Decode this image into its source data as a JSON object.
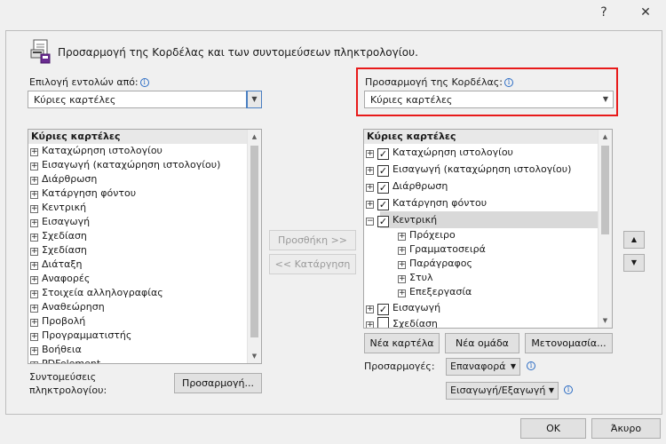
{
  "window": {
    "help_symbol": "?",
    "close_symbol": "✕"
  },
  "header": {
    "title": "Προσαρμογή της Κορδέλας και των συντομεύσεων πληκτρολογίου."
  },
  "left": {
    "choose_label": "Επιλογή εντολών από:",
    "choose_value": "Κύριες καρτέλες",
    "list_header": "Κύριες καρτέλες",
    "items": [
      "Καταχώρηση ιστολογίου",
      "Εισαγωγή (καταχώρηση ιστολογίου)",
      "Διάρθρωση",
      "Κατάργηση φόντου",
      "Κεντρική",
      "Εισαγωγή",
      "Σχεδίαση",
      "Σχεδίαση",
      "Διάταξη",
      "Αναφορές",
      "Στοιχεία αλληλογραφίας",
      "Αναθεώρηση",
      "Προβολή",
      "Προγραμματιστής",
      "Βοήθεια",
      "PDFelement"
    ]
  },
  "middle": {
    "add_label": "Προσθήκη >>",
    "remove_label": "<< Κατάργηση"
  },
  "right": {
    "customize_label": "Προσαρμογή της Κορδέλας:",
    "customize_value": "Κύριες καρτέλες",
    "list_header": "Κύριες καρτέλες",
    "items": [
      {
        "label": "Καταχώρηση ιστολογίου",
        "checked": true
      },
      {
        "label": "Εισαγωγή (καταχώρηση ιστολογίου)",
        "checked": true
      },
      {
        "label": "Διάρθρωση",
        "checked": true
      },
      {
        "label": "Κατάργηση φόντου",
        "checked": true
      },
      {
        "label": "Κεντρική",
        "checked": true,
        "expanded": true,
        "selected": true
      },
      {
        "label": "Πρόχειρο",
        "child": true
      },
      {
        "label": "Γραμματοσειρά",
        "child": true
      },
      {
        "label": "Παράγραφος",
        "child": true
      },
      {
        "label": "Στυλ",
        "child": true
      },
      {
        "label": "Επεξεργασία",
        "child": true
      },
      {
        "label": "Εισαγωγή",
        "checked": true
      },
      {
        "label": "Σχεδίαση",
        "checked": false
      }
    ],
    "new_tab_label": "Νέα καρτέλα",
    "new_group_label": "Νέα ομάδα",
    "rename_label": "Μετονομασία...",
    "customizations_label": "Προσαρμογές:",
    "reset_label": "Επαναφορά",
    "import_export_label": "Εισαγωγή/Εξαγωγή"
  },
  "shortcuts": {
    "label_line1": "Συντομεύσεις",
    "label_line2": "πληκτρολογίου:",
    "button_label": "Προσαρμογή..."
  },
  "footer": {
    "ok_label": "OK",
    "cancel_label": "Άκυρο"
  },
  "colors": {
    "highlight_border": "#e81a1a",
    "info_blue": "#2b6cc4"
  }
}
